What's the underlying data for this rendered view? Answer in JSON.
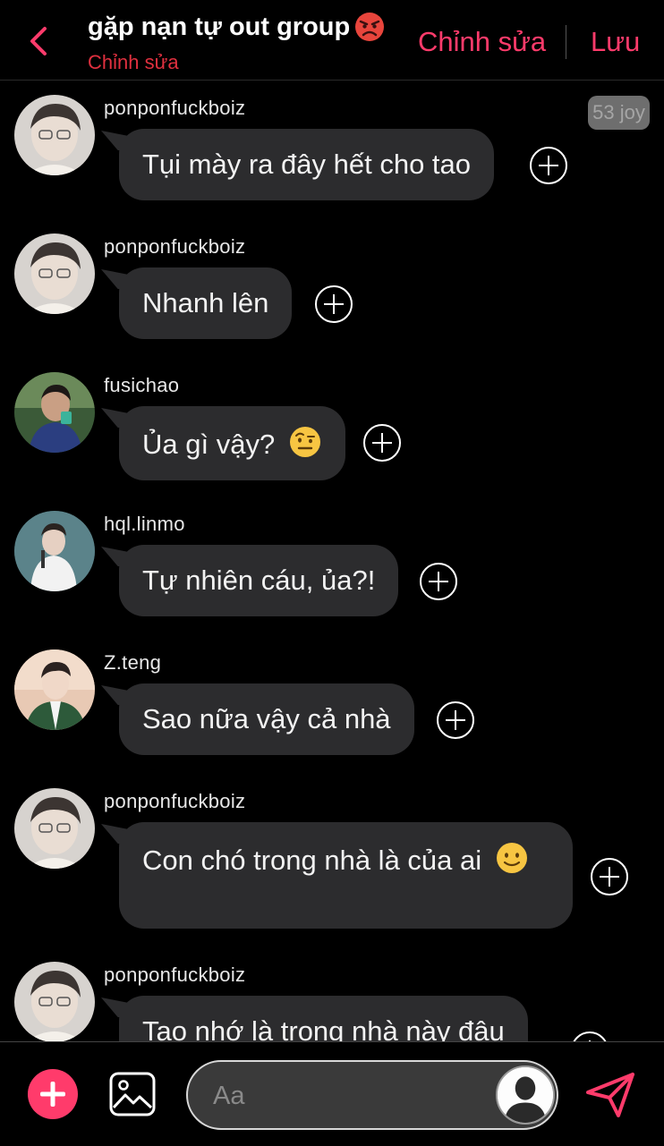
{
  "header": {
    "title": "gặp nạn tự out group",
    "title_emoji": "angry-face-emoji",
    "subtitle": "Chỉnh sửa",
    "edit_label": "Chỉnh sửa",
    "save_label": "Lưu",
    "accent_color": "#ff3b6b"
  },
  "badge": "53 joy",
  "messages": [
    {
      "username": "ponponfuckboiz",
      "text": "Tụi mày ra đây hết cho tao",
      "avatar": "avatar-light"
    },
    {
      "username": "ponponfuckboiz",
      "text": "Nhanh lên",
      "avatar": "avatar-light"
    },
    {
      "username": "fusichao",
      "text": "Ủa gì vậy?",
      "emoji": "raised-eyebrow-emoji",
      "avatar": "avatar-dark"
    },
    {
      "username": "hql.linmo",
      "text": "Tự nhiên cáu, ủa?!",
      "avatar": "avatar-teal"
    },
    {
      "username": "Z.teng",
      "text": "Sao nữa vậy cả nhà",
      "avatar": "avatar-green"
    },
    {
      "username": "ponponfuckboiz",
      "text": "Con chó trong nhà là của ai",
      "emoji": "slightly-smiling-face-emoji",
      "avatar": "avatar-light"
    },
    {
      "username": "ponponfuckboiz",
      "text": "Tao nhớ là trong nhà này đâu",
      "avatar": "avatar-light"
    }
  ],
  "composer": {
    "placeholder": "Aa"
  },
  "icons": {
    "back": "chevron-left-icon",
    "add": "plus-icon",
    "image": "image-icon",
    "send": "send-icon",
    "profile": "user-silhouette-icon",
    "react": "plus-circle-icon"
  }
}
